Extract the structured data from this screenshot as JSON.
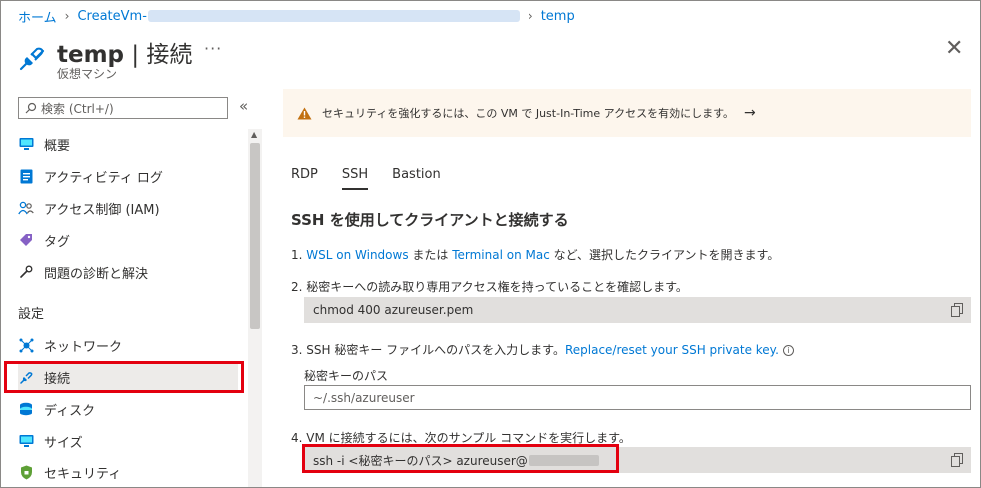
{
  "breadcrumb": {
    "home": "ホーム",
    "resource": "CreateVm-",
    "current": "temp"
  },
  "header": {
    "title_name": "temp",
    "title_section": "| 接続",
    "subtitle": "仮想マシン",
    "more": "···",
    "close": "✕"
  },
  "sidebar": {
    "search_placeholder": "検索 (Ctrl+/)",
    "collapse": "«",
    "items": [
      {
        "label": "概要",
        "icon": "monitor-icon"
      },
      {
        "label": "アクティビティ ログ",
        "icon": "activity-log-icon"
      },
      {
        "label": "アクセス制御 (IAM)",
        "icon": "people-icon"
      },
      {
        "label": "タグ",
        "icon": "tag-icon"
      },
      {
        "label": "問題の診断と解決",
        "icon": "wrench-icon"
      }
    ],
    "section_settings": "設定",
    "settings_items": [
      {
        "label": "ネットワーク",
        "icon": "network-icon"
      },
      {
        "label": "接続",
        "icon": "plug-icon",
        "selected": true
      },
      {
        "label": "ディスク",
        "icon": "disk-icon"
      },
      {
        "label": "サイズ",
        "icon": "monitor-icon"
      },
      {
        "label": "セキュリティ",
        "icon": "shield-icon"
      }
    ]
  },
  "banner": {
    "text": "セキュリティを強化するには、この VM で Just-In-Time アクセスを有効にします。",
    "arrow": "→"
  },
  "tabs": [
    "RDP",
    "SSH",
    "Bastion"
  ],
  "active_tab": "SSH",
  "ssh": {
    "heading": "SSH を使用してクライアントと接続する",
    "step1_prefix": "1. ",
    "step1_link1": "WSL on Windows",
    "step1_mid": " または ",
    "step1_link2": "Terminal on Mac",
    "step1_suffix": " など、選択したクライアントを開きます。",
    "step2": "2. 秘密キーへの読み取り専用アクセス権を持っていることを確認します。",
    "step2_command": "chmod 400 azureuser.pem",
    "step3_prefix": "3. SSH 秘密キー ファイルへのパスを入力します。",
    "step3_link": "Replace/reset your SSH private key.",
    "path_label": "秘密キーのパス",
    "path_value": "~/.ssh/azureuser",
    "step4": "4. VM に接続するには、次のサンプル コマンドを実行します。",
    "step4_command": "ssh -i <秘密キーのパス> azureuser@"
  },
  "colors": {
    "accent": "#0078d4",
    "highlight": "#e3000f",
    "banner_bg": "#fdf6ed",
    "warning": "#c2700f"
  }
}
